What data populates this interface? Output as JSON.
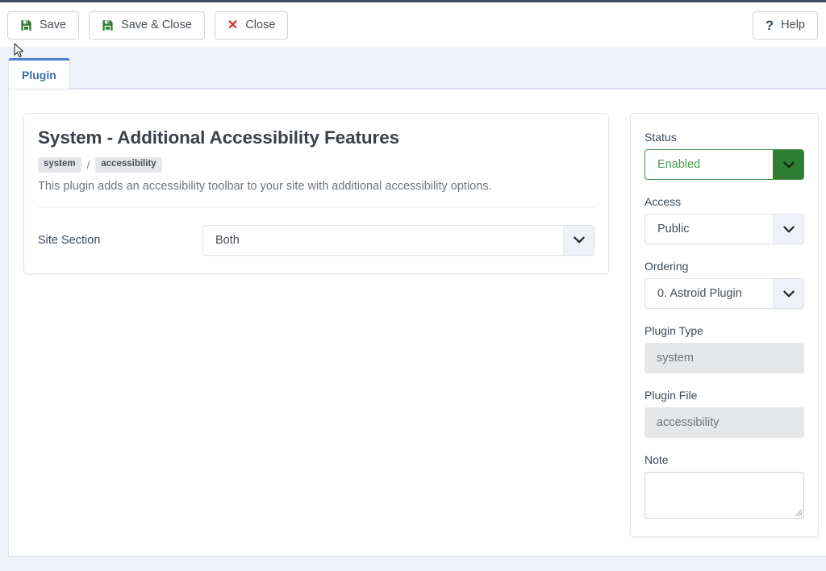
{
  "toolbar": {
    "save_label": "Save",
    "save_close_label": "Save & Close",
    "close_label": "Close",
    "help_label": "Help",
    "save_icon": "floppy-disk-icon",
    "close_icon": "x-icon",
    "help_icon": "question-mark-icon",
    "accent_green": "#2f7d32",
    "accent_red": "#c9302c"
  },
  "tabs": [
    {
      "label": "Plugin",
      "active": true
    }
  ],
  "main": {
    "title": "System - Additional Accessibility Features",
    "badges": [
      "system",
      "accessibility"
    ],
    "badge_separator": "/",
    "description": "This plugin adds an accessibility toolbar to your site with additional accessibility options.",
    "fields": [
      {
        "label": "Site Section",
        "value": "Both",
        "type": "select"
      }
    ]
  },
  "sidebar": {
    "status": {
      "label": "Status",
      "value": "Enabled",
      "type": "select",
      "state_color": "#2f7d32"
    },
    "access": {
      "label": "Access",
      "value": "Public",
      "type": "select"
    },
    "ordering": {
      "label": "Ordering",
      "value": "0. Astroid Plugin",
      "type": "select"
    },
    "plugin_type": {
      "label": "Plugin Type",
      "value": "system",
      "type": "readonly"
    },
    "plugin_file": {
      "label": "Plugin File",
      "value": "accessibility",
      "type": "readonly"
    },
    "note": {
      "label": "Note",
      "value": "",
      "placeholder": "",
      "type": "textarea"
    }
  }
}
